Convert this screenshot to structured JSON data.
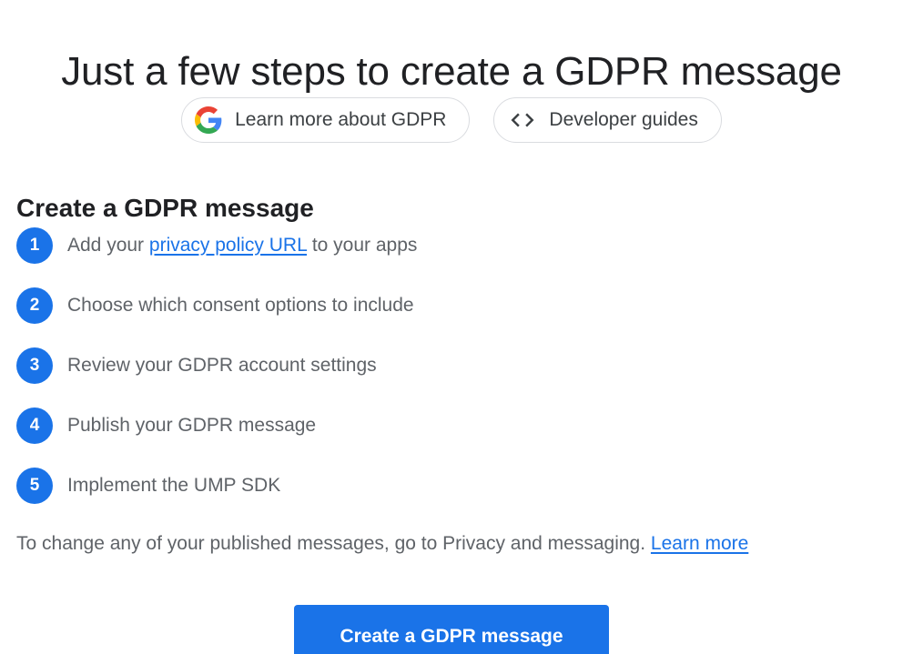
{
  "header": {
    "title": "Just a few steps to create a GDPR message"
  },
  "chips": {
    "learn_more": {
      "label": "Learn more about GDPR",
      "icon": "google-g-icon"
    },
    "developer_guides": {
      "label": "Developer guides",
      "icon": "code-icon"
    }
  },
  "section": {
    "title": "Create a GDPR message"
  },
  "steps": [
    {
      "number": "1",
      "before": "Add your ",
      "link": "privacy policy URL",
      "after": " to your apps"
    },
    {
      "number": "2",
      "text": "Choose which consent options to include"
    },
    {
      "number": "3",
      "text": "Review your GDPR account settings"
    },
    {
      "number": "4",
      "text": "Publish your GDPR message"
    },
    {
      "number": "5",
      "text": "Implement the UMP SDK"
    }
  ],
  "footer": {
    "text": "To change any of your published messages, go to Privacy and messaging. ",
    "link": "Learn more"
  },
  "primary_button": {
    "label": "Create a GDPR message"
  },
  "colors": {
    "accent": "#1a73e8",
    "title_text": "#202124",
    "body_text": "#5f6368",
    "chip_border": "#dadce0",
    "google_blue": "#4285F4",
    "google_red": "#EA4335",
    "google_yellow": "#FBBC05",
    "google_green": "#34A853"
  }
}
